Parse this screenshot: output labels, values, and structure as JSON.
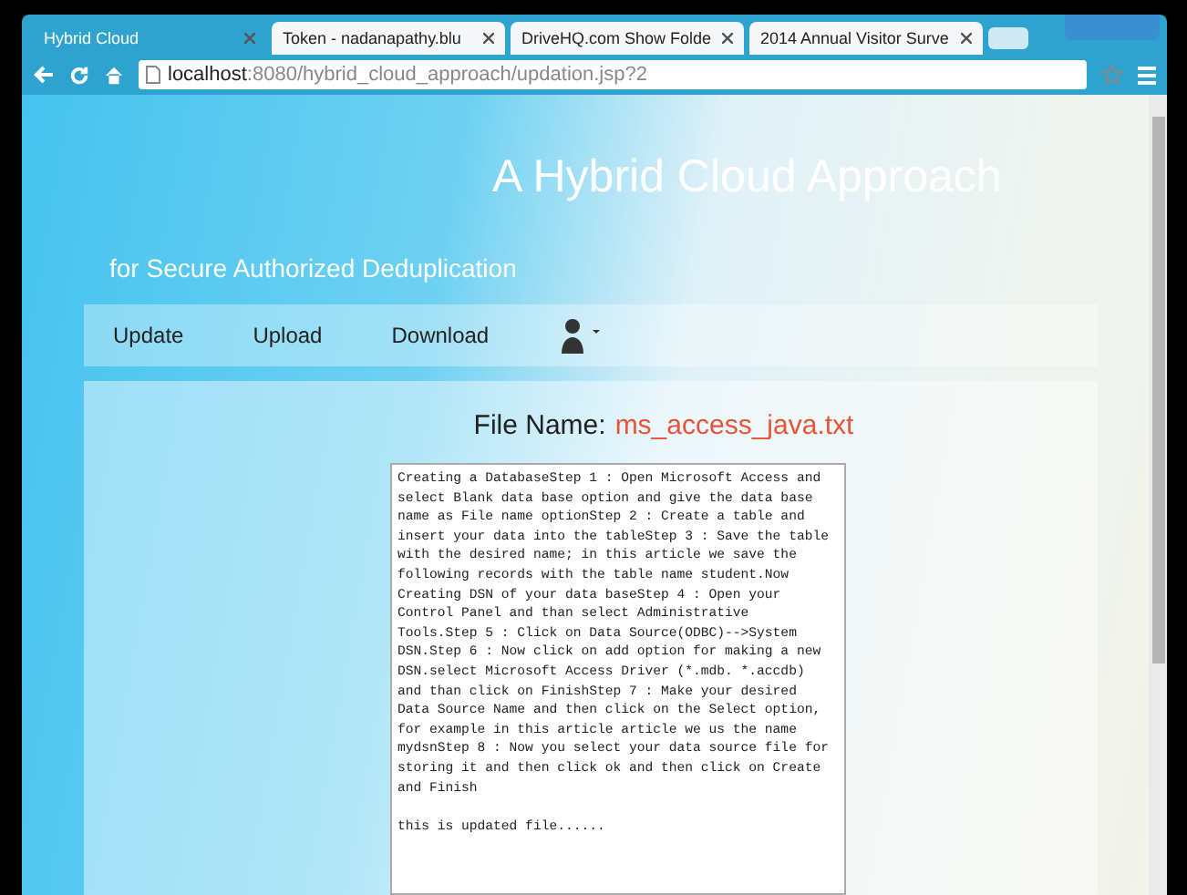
{
  "browser": {
    "tabs": [
      {
        "title": "Hybrid Cloud",
        "selected": true
      },
      {
        "title": "Token - nadanapathy.blu",
        "selected": false
      },
      {
        "title": "DriveHQ.com Show Folde",
        "selected": false
      },
      {
        "title": "2014 Annual Visitor Surve",
        "selected": false
      }
    ],
    "address": {
      "host": "localhost",
      "rest": ":8080/hybrid_cloud_approach/updation.jsp?2"
    }
  },
  "page": {
    "title": "A Hybrid Cloud Approach",
    "subtitle": "for Secure Authorized Deduplication",
    "nav": [
      "Update",
      "Upload",
      "Download"
    ],
    "file_label": "File Name:",
    "file_name": "ms_access_java.txt",
    "content_lines": [
      "Creating a DatabaseStep 1 : Open Microsoft Access and",
      "select Blank data base option and give the data base",
      "name as File name optionStep 2 : Create a table and",
      "insert your data into the tableStep 3 : Save the table",
      "with the desired name; in this article we save the",
      "following records with the table name student.Now",
      "Creating DSN of your data baseStep 4 : Open your",
      "Control Panel and than select Administrative",
      "Tools.Step 5 : Click on Data Source(ODBC)-->System",
      "DSN.Step 6 : Now click on add option for making a new",
      "DSN.select Microsoft Access Driver (*.mdb. *.accdb)",
      "and than click on FinishStep 7 : Make your desired",
      "Data Source Name and then click on the Select option,",
      "for example in this article article we us the name",
      "mydsnStep 8 : Now you select your data source file for",
      "storing it and then click ok and then click on Create",
      "and Finish"
    ],
    "note": "this is updated file......"
  }
}
